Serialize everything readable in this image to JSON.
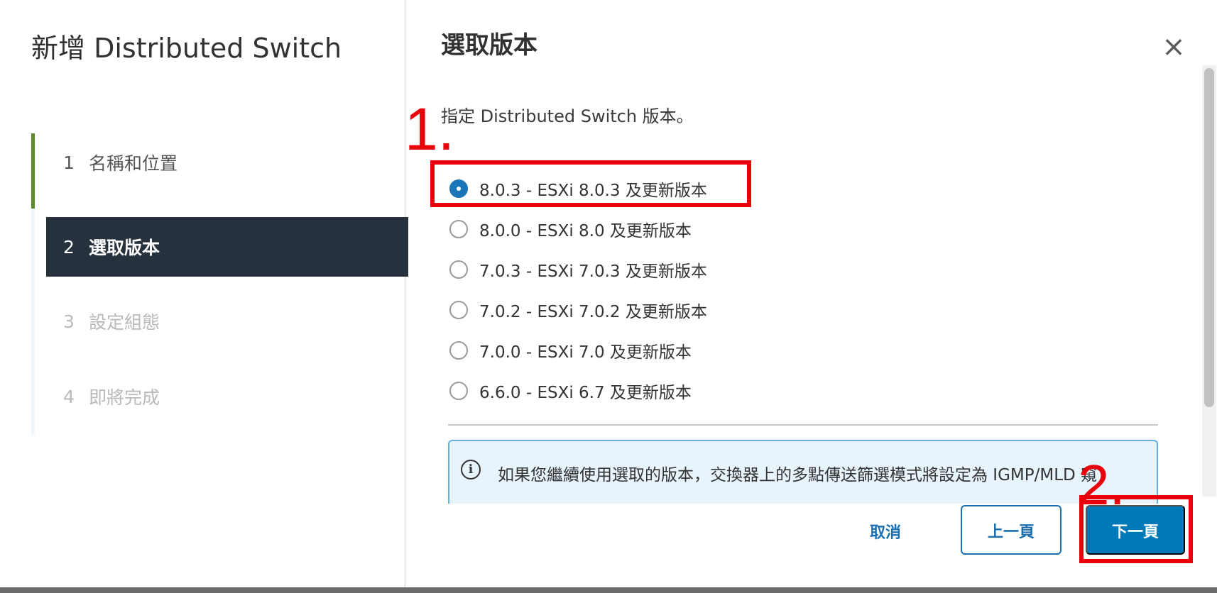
{
  "sidebar": {
    "title": "新增 Distributed Switch",
    "steps": [
      {
        "number": "1",
        "label": "名稱和位置"
      },
      {
        "number": "2",
        "label": "選取版本"
      },
      {
        "number": "3",
        "label": "設定組態"
      },
      {
        "number": "4",
        "label": "即將完成"
      }
    ]
  },
  "main": {
    "title": "選取版本",
    "close_symbol": "×",
    "instruction": "指定 Distributed Switch 版本。",
    "options": [
      {
        "label": "8.0.3 - ESXi 8.0.3 及更新版本",
        "selected": true
      },
      {
        "label": "8.0.0 - ESXi 8.0 及更新版本",
        "selected": false
      },
      {
        "label": "7.0.3 - ESXi 7.0.3 及更新版本",
        "selected": false
      },
      {
        "label": "7.0.2 - ESXi 7.0.2 及更新版本",
        "selected": false
      },
      {
        "label": "7.0.0 - ESXi 7.0 及更新版本",
        "selected": false
      },
      {
        "label": "6.6.0 - ESXi 6.7 及更新版本",
        "selected": false
      }
    ],
    "alert": {
      "icon": "info-icon",
      "icon_glyph": "i",
      "text": "如果您繼續使用選取的版本，交換器上的多點傳送篩選模式將設定為 IGMP/MLD 窺探。"
    }
  },
  "footer": {
    "cancel_label": "取消",
    "back_label": "上一頁",
    "next_label": "下一頁"
  },
  "annotations": {
    "label_1": "1.",
    "label_2": "2.",
    "color": "#e8000b"
  },
  "colors": {
    "accent": "#0079b8",
    "sidebar_active_bg": "#25313c",
    "step_complete_bar": "#5d8b2e",
    "alert_bg": "#e7f4fc",
    "alert_border": "#65b0dd"
  }
}
